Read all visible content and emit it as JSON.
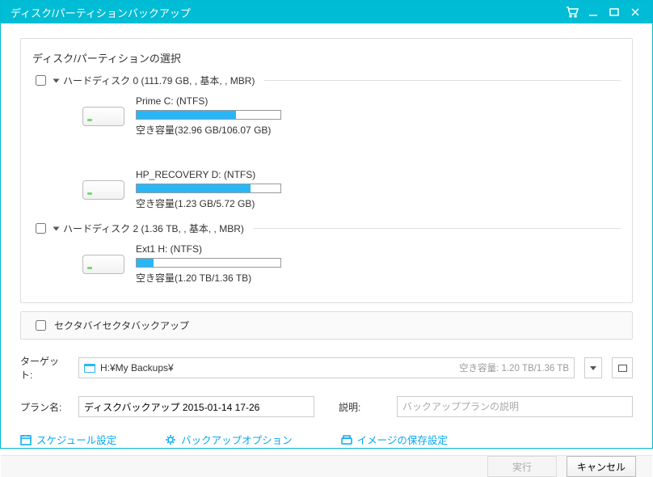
{
  "window": {
    "title": "ディスク/パーティションバックアップ"
  },
  "panel": {
    "title": "ディスク/パーティションの選択"
  },
  "disks": [
    {
      "label": "ハードディスク 0 (111.79 GB, , 基本, , MBR)",
      "partitions": [
        {
          "name": "Prime C: (NTFS)",
          "free_label": "空き容量(32.96 GB/106.07 GB)",
          "fill_pct": 69
        },
        {
          "name": "HP_RECOVERY D: (NTFS)",
          "free_label": "空き容量(1.23 GB/5.72 GB)",
          "fill_pct": 79
        }
      ]
    },
    {
      "label": "ハードディスク 2 (1.36 TB, , 基本, , MBR)",
      "partitions": [
        {
          "name": "Ext1 H: (NTFS)",
          "free_label": "空き容量(1.20 TB/1.36 TB)",
          "fill_pct": 12
        }
      ]
    }
  ],
  "sector": {
    "label": "セクタバイセクタバックアップ"
  },
  "target": {
    "label": "ターゲット:",
    "path": "H:¥My Backups¥",
    "free": "空き容量: 1.20 TB/1.36 TB"
  },
  "plan": {
    "label": "プラン名:",
    "value": "ディスクバックアップ 2015-01-14 17-26"
  },
  "description": {
    "label": "説明:",
    "placeholder": "バックアッププランの説明"
  },
  "links": {
    "schedule": "スケジュール設定",
    "options": "バックアップオプション",
    "image": "イメージの保存設定"
  },
  "buttons": {
    "execute": "実行",
    "cancel": "キャンセル"
  }
}
